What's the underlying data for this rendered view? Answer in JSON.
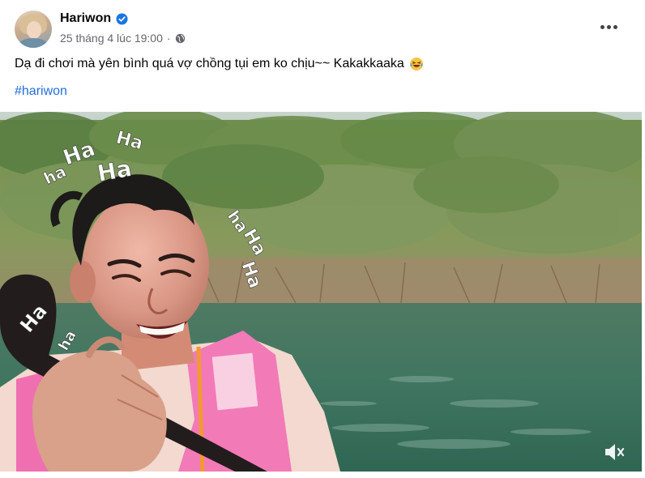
{
  "post": {
    "author": "Hariwon",
    "timestamp": "25 tháng 4 lúc 19:00",
    "separator": "·",
    "privacy_icon": "globe-icon",
    "verified_icon": "verified-badge-icon",
    "more_icon": "more-options-icon",
    "text": "Dạ đi chơi mà yên bình quá vợ chồng tụi em ko chịu~~ Kakakkaaka",
    "text_emoji": "laughing-with-tears-emoji",
    "hashtag": "#hariwon"
  },
  "video": {
    "overlay_words": {
      "w1": "ha",
      "w2": "Ha",
      "w3": "Ha",
      "w4": "Ha",
      "w5": "ha",
      "w6": "Ha",
      "w7": "Ha",
      "w8": "Ha",
      "w9": "ha"
    },
    "mute_icon": "muted-speaker-icon"
  },
  "colors": {
    "link": "#216fdb",
    "secondary_text": "#65676b",
    "verified_blue": "#1b74e4"
  }
}
